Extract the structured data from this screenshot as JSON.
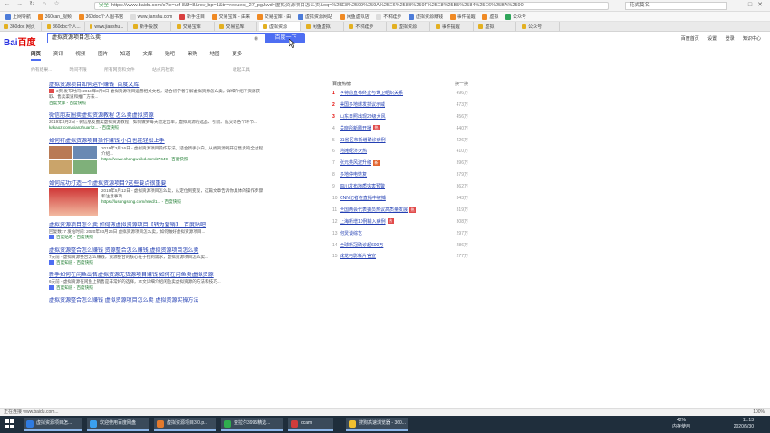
{
  "browser": {
    "secure_label": "安全",
    "url": "https://www.baidu.com/s?ie=utf-8&f=8&rsv_bp=1&tn=request_27_pg&wd=虚拟资源项目怎么卖&oq=%25E8%2599%259A%25E6%258B%259F%25E8%25B5%2584%25E6%25BA%2590",
    "search_placeholder": "花式莫名",
    "bookmarks": [
      "上网导航",
      "360kan_视频",
      "360doc个人图书馆",
      "www.jianshu.com",
      "新手注目",
      "交易宝库 - 由来",
      "交易宝库 - 由",
      "虚拟资源网站",
      "闲鱼虚拟店",
      "不积跬步",
      "虚拟资源赚钱",
      "事件提醒",
      "虚拟",
      "公众号"
    ],
    "tabs": [
      "360doc 网页",
      "360doc个人...",
      "www.jianshu...",
      "新手投放",
      "交易宝库",
      "交易宝库",
      "虚拟资源",
      "闲鱼虚拟",
      "不积跬步",
      "虚拟资源",
      "事件提醒",
      "虚拟",
      "公众号"
    ]
  },
  "baidu": {
    "logo_main": "Bai",
    "logo_red": "百度",
    "query": "虚拟资源项目怎么卖",
    "search_button": "百度一下",
    "header_links": [
      "百度首页",
      "设置",
      "登录",
      "知识中心"
    ]
  },
  "vertical_tabs": [
    "网页",
    "资讯",
    "视频",
    "图片",
    "知道",
    "文库",
    "贴吧",
    "采购",
    "地图",
    "更多"
  ],
  "tools": {
    "count": "约有结果...",
    "filter1": "时间不限",
    "filter2": "所有网页和文件",
    "filter3": "站点内检索",
    "right": "收起工具"
  },
  "results": [
    {
      "title": "虚拟资源项目如何运作赚钱_百度文库",
      "desc": "3页 发布时间: 2018年3月9日 虚拟资源项目运营相关文档，适合初学者了解虚拟资源怎么卖，详细介绍了资源获取、售卖渠道和推广方法...",
      "url": "百度文库 - 百度快照"
    },
    {
      "title": "微信朋友圈卖虚拟资源教程 怎么卖虚拟资源",
      "desc": "2019年8月2日 - 微信朋友圈卖虚拟资源教程，如何做到每天稳定出单，虚拟资源的选品、引流、成交等各个环节...",
      "url": "kakaoz.com/xianzhuan/2... - 百度快照"
    },
    {
      "title": "如何将虚拟资源项目操作赚钱 小白也能轻松上手",
      "desc": "2019年3月16日 - 虚拟资源项目操作方法，适合新手小白，从找资源到开店售卖的全过程介绍...",
      "url": "https://www.shangweikd.com/27649 - 百度快照"
    },
    {
      "title": "如何成功打造一个虚拟资源项目?这些要点很重要",
      "desc": "2019年5月12日 - 虚拟资源项目怎么卖，从定位到变现，这篇文章告诉你具体的操作步骤和注意事项...",
      "url": "https://lusongsong.com/reed/1... - 百度快照"
    },
    {
      "title": "虚拟资源项目怎么卖 如何做虚拟资源项目【转为营销】_百度贴吧",
      "desc": "回复数: 7 发帖时间: 2020年03月26日 虚拟资源项目怎么卖，如何做好虚拟资源项目...",
      "url": "百度贴吧 - 百度快照"
    },
    {
      "title": "虚拟资源整合怎么赚钱 资源整合怎么赚钱 虚拟资源项目怎么卖",
      "desc": "7天前 - 虚拟资源整合怎么赚钱，资源整合的核心在于找到需求，虚拟资源项目怎么卖...",
      "url": "百度知道 - 百度快照"
    },
    {
      "title": "新手如何在闲鱼出售虚拟资源无货源项目赚钱 如何在闲鱼卖虚拟资源",
      "desc": "6天前 - 虚拟资源在闲鱼上销售是非常好的选择，本文详细介绍闲鱼卖虚拟资源的方法和技巧...",
      "url": "百度知道 - 百度快照"
    },
    {
      "title": "虚拟资源整合怎么赚钱 虚拟资源项目怎么卖 虚拟资源实操方法",
      "desc": "",
      "url": ""
    }
  ],
  "hot": {
    "title": "百度热榜",
    "refresh": "换一换",
    "items": [
      {
        "n": "1",
        "t": "亨特前宣布终止与世卫组织关系",
        "tag": "",
        "v": "496万"
      },
      {
        "n": "2",
        "t": "美国多地爆发抗议示威",
        "tag": "",
        "v": "473万"
      },
      {
        "n": "3",
        "t": "山东日照出现29级大风",
        "tag": "",
        "v": "456万"
      },
      {
        "n": "4",
        "t": "关晓彤新剧开播",
        "tag": "热",
        "v": "440万"
      },
      {
        "n": "5",
        "t": "31省区市新增确诊病例",
        "tag": "",
        "v": "426万"
      },
      {
        "n": "6",
        "t": "地摊经济火热",
        "tag": "",
        "v": "410万"
      },
      {
        "n": "7",
        "t": "张元英风波升级",
        "tag": "新",
        "v": "396万"
      },
      {
        "n": "8",
        "t": "多地停电恢复",
        "tag": "",
        "v": "379万"
      },
      {
        "n": "9",
        "t": "四川发布地质灾害预警",
        "tag": "",
        "v": "362万"
      },
      {
        "n": "10",
        "t": "CNN记者在直播中被捕",
        "tag": "",
        "v": "343万"
      },
      {
        "n": "11",
        "t": "全国两会代表委员热议高质量发展",
        "tag": "热",
        "v": "319万"
      },
      {
        "n": "12",
        "t": "上海新增10例输入病例",
        "tag": "热",
        "v": "308万"
      },
      {
        "n": "13",
        "t": "何炅谈综艺",
        "tag": "",
        "v": "297万"
      },
      {
        "n": "14",
        "t": "全球新冠确诊超600万",
        "tag": "",
        "v": "286万"
      },
      {
        "n": "15",
        "t": "成龙电影新片官宣",
        "tag": "",
        "v": "277万"
      }
    ]
  },
  "status": {
    "left": "正在连接 www.baidu.com...",
    "right": "100%"
  },
  "taskbar": {
    "apps": [
      "虚拟资源项目怎...",
      "欢迎使用百度网盘",
      "虚拟资源项目3.0.p...",
      "亚拉尔3995精选...",
      "ocam",
      "搜狗高速浏览器 - 360..."
    ],
    "mem_label": "42%",
    "mem_sub": "内存使用",
    "time": "11:13",
    "date": "2020/5/30"
  }
}
